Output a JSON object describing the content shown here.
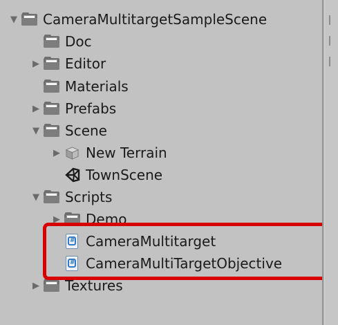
{
  "tree": {
    "root": {
      "label": "CameraMultitargetSampleScene",
      "icon": "folder-icon",
      "expanded": true
    },
    "items": [
      {
        "label": "Doc",
        "icon": "folder-icon",
        "arrow": "none"
      },
      {
        "label": "Editor",
        "icon": "folder-icon",
        "arrow": "collapsed"
      },
      {
        "label": "Materials",
        "icon": "folder-icon",
        "arrow": "none"
      },
      {
        "label": "Prefabs",
        "icon": "folder-icon",
        "arrow": "collapsed"
      },
      {
        "label": "Scene",
        "icon": "folder-icon",
        "arrow": "expanded"
      },
      {
        "label": "New Terrain",
        "icon": "terrain-prefab-icon",
        "arrow": "collapsed"
      },
      {
        "label": "TownScene",
        "icon": "unity-scene-icon",
        "arrow": "none"
      },
      {
        "label": "Scripts",
        "icon": "folder-icon",
        "arrow": "expanded"
      },
      {
        "label": "Demo",
        "icon": "folder-icon",
        "arrow": "collapsed"
      },
      {
        "label": "CameraMultitarget",
        "icon": "csharp-script-icon",
        "arrow": "none"
      },
      {
        "label": "CameraMultiTargetObjective",
        "icon": "csharp-script-icon",
        "arrow": "none"
      },
      {
        "label": "Textures",
        "icon": "folder-icon",
        "arrow": "collapsed"
      }
    ]
  },
  "annotation": {
    "color": "#d80000"
  }
}
